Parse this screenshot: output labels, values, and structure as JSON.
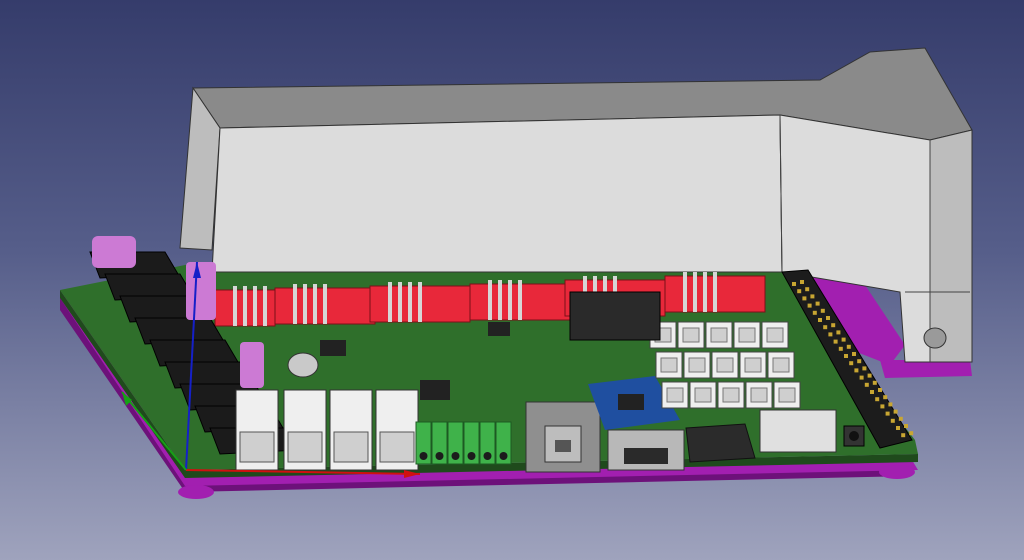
{
  "viewport": {
    "view": "3d-cad-viewport",
    "background": {
      "top": "#353c6b",
      "bottom": "#9fa3bd"
    }
  },
  "colors": {
    "case_face": "#dcdcdc",
    "case_top": "#8a8a8a",
    "case_side": "#bdbdbd",
    "pcb": "#2f6f2b",
    "pcb_dark": "#1f4a1c",
    "base_plate": "#a21fb0",
    "base_plate_dark": "#6d117a",
    "driver_header": "#e8283a",
    "heatsink": "#1b1b1b",
    "terminal_green": "#3fb24a",
    "usb_grey": "#8f8f8f",
    "module_blue": "#1f4fa0",
    "connector_white": "#efefef",
    "capacitor_pink": "#cc7ad4",
    "axis_x": "#d01010",
    "axis_y": "#16a016",
    "axis_z": "#1520c8"
  },
  "parts": [
    {
      "id": "enclosure",
      "icon": "enclosure-shape"
    },
    {
      "id": "pcb",
      "icon": "board-shape"
    },
    {
      "id": "base-plate",
      "icon": "plate-shape"
    },
    {
      "id": "heatsink",
      "icon": "heatsink-shape"
    },
    {
      "id": "stepper-headers",
      "icon": "header-shape"
    },
    {
      "id": "screw-terminals",
      "icon": "terminal-shape"
    },
    {
      "id": "usb-b-port",
      "icon": "usb-b-shape"
    },
    {
      "id": "usb-a-port",
      "icon": "usb-a-shape"
    },
    {
      "id": "wifi-module",
      "icon": "module-shape"
    },
    {
      "id": "jst-connectors",
      "icon": "connector-shape"
    },
    {
      "id": "pin-header-expansion",
      "icon": "pinheader-shape"
    },
    {
      "id": "axis-indicator",
      "icon": "axis-triad-icon"
    }
  ]
}
